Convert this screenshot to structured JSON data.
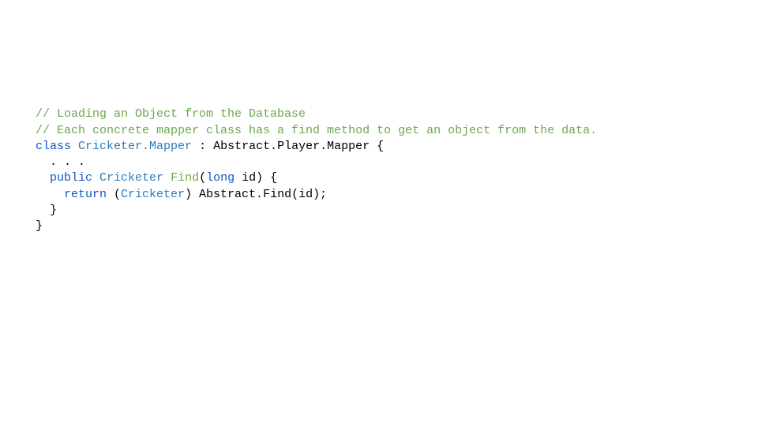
{
  "code": {
    "line1": "// Loading an Object from the Database",
    "line2": "// Each concrete mapper class has a find method to get an object from the data.",
    "kw_class": "class",
    "type_mapper": "Cricketer.Mapper",
    "afterClass": " : Abstract.Player.Mapper {",
    "ellipsis": ". . .",
    "kw_public": "public",
    "type_cricketer": "Cricketer",
    "method_find": "Find",
    "openParen": "(",
    "kw_long": "long",
    "param_id": " id) {",
    "kw_return": "return",
    "cast_open": " (",
    "type_cricketer2": "Cricketer",
    "cast_close": ") Abstract.Find(id);",
    "closeInner": "}",
    "closeOuter": "}"
  }
}
